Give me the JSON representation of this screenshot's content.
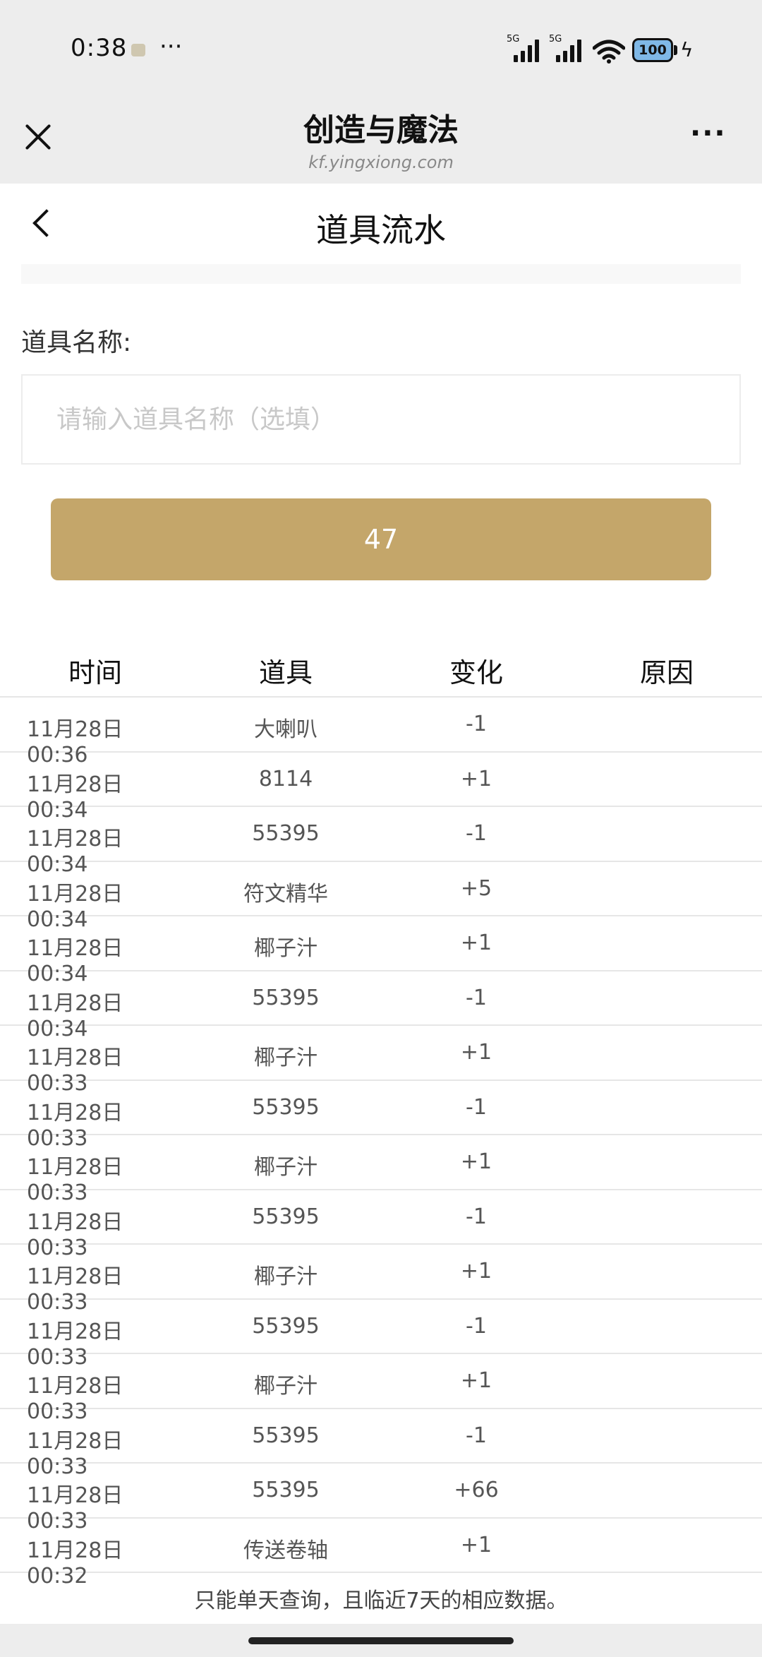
{
  "status_bar": {
    "time": "0:38",
    "dots": "···",
    "signal_1_label": "5G",
    "signal_2_label": "5G",
    "battery": "100"
  },
  "wechat_nav": {
    "title": "创造与魔法",
    "subtitle": "kf.yingxiong.com",
    "more": "···"
  },
  "page": {
    "title": "道具流水"
  },
  "form": {
    "label": "道具名称:",
    "placeholder": "请输入道具名称（选填）",
    "value": "",
    "button_label": "47"
  },
  "table": {
    "headers": [
      "时间",
      "道具",
      "变化",
      "原因"
    ],
    "rows": [
      {
        "time": "11月28日 00:36",
        "item": "大喇叭",
        "change": "-1",
        "reason": ""
      },
      {
        "time": "11月28日 00:34",
        "item": "8114",
        "change": "+1",
        "reason": ""
      },
      {
        "time": "11月28日 00:34",
        "item": "55395",
        "change": "-1",
        "reason": ""
      },
      {
        "time": "11月28日 00:34",
        "item": "符文精华",
        "change": "+5",
        "reason": ""
      },
      {
        "time": "11月28日 00:34",
        "item": "椰子汁",
        "change": "+1",
        "reason": ""
      },
      {
        "time": "11月28日 00:34",
        "item": "55395",
        "change": "-1",
        "reason": ""
      },
      {
        "time": "11月28日 00:33",
        "item": "椰子汁",
        "change": "+1",
        "reason": ""
      },
      {
        "time": "11月28日 00:33",
        "item": "55395",
        "change": "-1",
        "reason": ""
      },
      {
        "time": "11月28日 00:33",
        "item": "椰子汁",
        "change": "+1",
        "reason": ""
      },
      {
        "time": "11月28日 00:33",
        "item": "55395",
        "change": "-1",
        "reason": ""
      },
      {
        "time": "11月28日 00:33",
        "item": "椰子汁",
        "change": "+1",
        "reason": ""
      },
      {
        "time": "11月28日 00:33",
        "item": "55395",
        "change": "-1",
        "reason": ""
      },
      {
        "time": "11月28日 00:33",
        "item": "椰子汁",
        "change": "+1",
        "reason": ""
      },
      {
        "time": "11月28日 00:33",
        "item": "55395",
        "change": "-1",
        "reason": ""
      },
      {
        "time": "11月28日 00:33",
        "item": "55395",
        "change": "+66",
        "reason": ""
      },
      {
        "time": "11月28日 00:32",
        "item": "传送卷轴",
        "change": "+1",
        "reason": ""
      }
    ]
  },
  "footer": {
    "note": "只能单天查询，且临近7天的相应数据。"
  },
  "colors": {
    "accent": "#c4a66a",
    "nav_bg": "#ededed"
  }
}
